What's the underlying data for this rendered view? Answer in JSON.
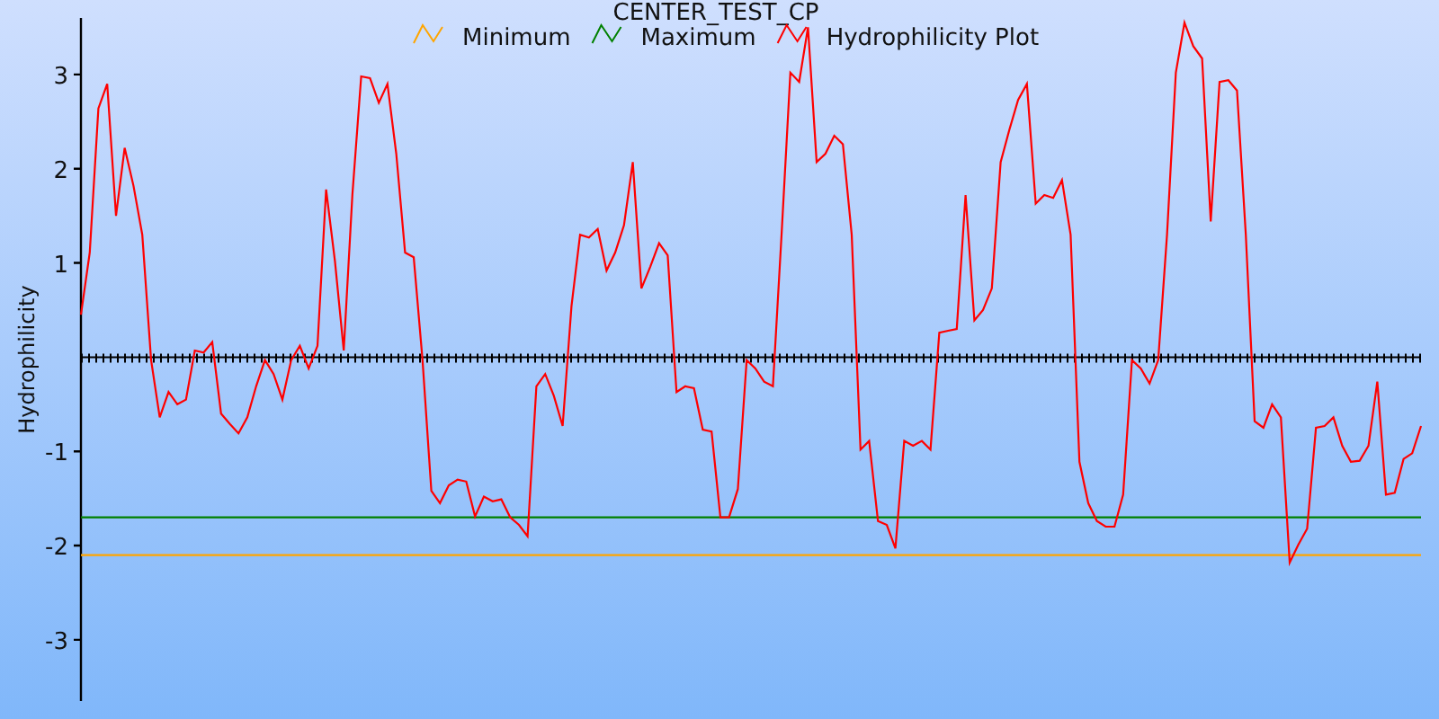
{
  "chart": {
    "chart_data": {
      "type": "line",
      "title": "CENTER_TEST_CP",
      "ylabel": "Hydrophilicity",
      "legend": "top",
      "ylim": [
        -3.65,
        3.6
      ],
      "yticks": [
        -3,
        -2,
        -1,
        1,
        2,
        3
      ],
      "categories": [
        null,
        null,
        null,
        null,
        null,
        null,
        null,
        null,
        null,
        null,
        null,
        null,
        null,
        null,
        null,
        null,
        null,
        null,
        null,
        null,
        null,
        null,
        null,
        null,
        null,
        null,
        null,
        null,
        null,
        null,
        null,
        null,
        null,
        null,
        null,
        null,
        null,
        null,
        null,
        null,
        null,
        null,
        null,
        null,
        null,
        null,
        null,
        null,
        null,
        null,
        null,
        null,
        null,
        null,
        null,
        null,
        null,
        null,
        null,
        null,
        null,
        null,
        null,
        null,
        null,
        null,
        null,
        null,
        null,
        null,
        null,
        null,
        null,
        null,
        null,
        null,
        null,
        null,
        null,
        null,
        null,
        null,
        null,
        null,
        null,
        null,
        null,
        null,
        null,
        null,
        null,
        null,
        null,
        null,
        null,
        null,
        null,
        null,
        null,
        null,
        null,
        null,
        null,
        null,
        null,
        null,
        null,
        null,
        null,
        null,
        null,
        null,
        null,
        null,
        null,
        null,
        null,
        null,
        null,
        null,
        null,
        null,
        null,
        null,
        null,
        null,
        null,
        null,
        null,
        null,
        null,
        null,
        null,
        null,
        null,
        null,
        null,
        null,
        null,
        null,
        null,
        null,
        null,
        null,
        null,
        null,
        null,
        null,
        null,
        null,
        null,
        null,
        null,
        null
      ],
      "series": [
        {
          "name": "Minimum",
          "color": "#ffa500",
          "values": [
            -2.1,
            -2.1,
            -2.1,
            -2.1,
            -2.1,
            -2.1,
            -2.1,
            -2.1,
            -2.1,
            -2.1,
            -2.1,
            -2.1,
            -2.1,
            -2.1,
            -2.1,
            -2.1,
            -2.1,
            -2.1,
            -2.1,
            -2.1,
            -2.1,
            -2.1,
            -2.1,
            -2.1,
            -2.1,
            -2.1,
            -2.1,
            -2.1,
            -2.1,
            -2.1,
            -2.1,
            -2.1,
            -2.1,
            -2.1,
            -2.1,
            -2.1,
            -2.1,
            -2.1,
            -2.1,
            -2.1,
            -2.1,
            -2.1,
            -2.1,
            -2.1,
            -2.1,
            -2.1,
            -2.1,
            -2.1,
            -2.1,
            -2.1,
            -2.1,
            -2.1,
            -2.1,
            -2.1,
            -2.1,
            -2.1,
            -2.1,
            -2.1,
            -2.1,
            -2.1,
            -2.1,
            -2.1,
            -2.1,
            -2.1,
            -2.1,
            -2.1,
            -2.1,
            -2.1,
            -2.1,
            -2.1,
            -2.1,
            -2.1,
            -2.1,
            -2.1,
            -2.1,
            -2.1,
            -2.1,
            -2.1,
            -2.1,
            -2.1,
            -2.1,
            -2.1,
            -2.1,
            -2.1,
            -2.1,
            -2.1,
            -2.1,
            -2.1,
            -2.1,
            -2.1,
            -2.1,
            -2.1,
            -2.1,
            -2.1,
            -2.1,
            -2.1,
            -2.1,
            -2.1,
            -2.1,
            -2.1,
            -2.1,
            -2.1,
            -2.1,
            -2.1,
            -2.1,
            -2.1,
            -2.1,
            -2.1,
            -2.1,
            -2.1,
            -2.1,
            -2.1,
            -2.1,
            -2.1,
            -2.1,
            -2.1,
            -2.1,
            -2.1,
            -2.1,
            -2.1,
            -2.1,
            -2.1,
            -2.1,
            -2.1,
            -2.1,
            -2.1,
            -2.1,
            -2.1,
            -2.1,
            -2.1,
            -2.1,
            -2.1,
            -2.1,
            -2.1,
            -2.1,
            -2.1,
            -2.1,
            -2.1,
            -2.1,
            -2.1,
            -2.1,
            -2.1,
            -2.1,
            -2.1,
            -2.1,
            -2.1,
            -2.1,
            -2.1,
            -2.1,
            -2.1,
            -2.1,
            -2.1,
            -2.1,
            -2.1
          ]
        },
        {
          "name": "Maximum",
          "color": "#008000",
          "values": [
            -1.7,
            -1.7,
            -1.7,
            -1.7,
            -1.7,
            -1.7,
            -1.7,
            -1.7,
            -1.7,
            -1.7,
            -1.7,
            -1.7,
            -1.7,
            -1.7,
            -1.7,
            -1.7,
            -1.7,
            -1.7,
            -1.7,
            -1.7,
            -1.7,
            -1.7,
            -1.7,
            -1.7,
            -1.7,
            -1.7,
            -1.7,
            -1.7,
            -1.7,
            -1.7,
            -1.7,
            -1.7,
            -1.7,
            -1.7,
            -1.7,
            -1.7,
            -1.7,
            -1.7,
            -1.7,
            -1.7,
            -1.7,
            -1.7,
            -1.7,
            -1.7,
            -1.7,
            -1.7,
            -1.7,
            -1.7,
            -1.7,
            -1.7,
            -1.7,
            -1.7,
            -1.7,
            -1.7,
            -1.7,
            -1.7,
            -1.7,
            -1.7,
            -1.7,
            -1.7,
            -1.7,
            -1.7,
            -1.7,
            -1.7,
            -1.7,
            -1.7,
            -1.7,
            -1.7,
            -1.7,
            -1.7,
            -1.7,
            -1.7,
            -1.7,
            -1.7,
            -1.7,
            -1.7,
            -1.7,
            -1.7,
            -1.7,
            -1.7,
            -1.7,
            -1.7,
            -1.7,
            -1.7,
            -1.7,
            -1.7,
            -1.7,
            -1.7,
            -1.7,
            -1.7,
            -1.7,
            -1.7,
            -1.7,
            -1.7,
            -1.7,
            -1.7,
            -1.7,
            -1.7,
            -1.7,
            -1.7,
            -1.7,
            -1.7,
            -1.7,
            -1.7,
            -1.7,
            -1.7,
            -1.7,
            -1.7,
            -1.7,
            -1.7,
            -1.7,
            -1.7,
            -1.7,
            -1.7,
            -1.7,
            -1.7,
            -1.7,
            -1.7,
            -1.7,
            -1.7,
            -1.7,
            -1.7,
            -1.7,
            -1.7,
            -1.7,
            -1.7,
            -1.7,
            -1.7,
            -1.7,
            -1.7,
            -1.7,
            -1.7,
            -1.7,
            -1.7,
            -1.7,
            -1.7,
            -1.7,
            -1.7,
            -1.7,
            -1.7,
            -1.7,
            -1.7,
            -1.7,
            -1.7,
            -1.7,
            -1.7,
            -1.7,
            -1.7,
            -1.7,
            -1.7,
            -1.7,
            -1.7,
            -1.7,
            -1.7
          ]
        },
        {
          "name": "Hydrophilicity Plot",
          "color": "#ff0000",
          "values": [
            0.45,
            1.11,
            2.64,
            2.9,
            1.5,
            2.22,
            1.82,
            1.3,
            -0.03,
            -0.64,
            -0.37,
            -0.5,
            -0.45,
            0.07,
            0.05,
            0.16,
            -0.6,
            -0.71,
            -0.81,
            -0.64,
            -0.31,
            -0.03,
            -0.18,
            -0.45,
            -0.03,
            0.12,
            -0.12,
            0.12,
            1.78,
            1.02,
            0.07,
            1.72,
            2.98,
            2.96,
            2.7,
            2.9,
            2.16,
            1.11,
            1.06,
            -0.03,
            -1.42,
            -1.55,
            -1.36,
            -1.3,
            -1.32,
            -1.69,
            -1.48,
            -1.53,
            -1.51,
            -1.7,
            -1.78,
            -1.9,
            -0.31,
            -0.18,
            -0.41,
            -0.73,
            0.54,
            1.3,
            1.27,
            1.36,
            0.92,
            1.11,
            1.4,
            2.07,
            0.73,
            0.96,
            1.21,
            1.08,
            -0.37,
            -0.31,
            -0.33,
            -0.77,
            -0.79,
            -1.7,
            -1.7,
            -1.4,
            -0.03,
            -0.12,
            -0.26,
            -0.31,
            1.3,
            3.02,
            2.92,
            3.5,
            2.07,
            2.16,
            2.35,
            2.26,
            1.3,
            -0.98,
            -0.89,
            -1.74,
            -1.78,
            -2.03,
            -0.89,
            -0.94,
            -0.89,
            -0.98,
            0.26,
            0.28,
            0.3,
            1.72,
            0.39,
            0.5,
            0.73,
            2.07,
            2.41,
            2.73,
            2.9,
            1.63,
            1.72,
            1.69,
            1.88,
            1.3,
            -1.11,
            -1.55,
            -1.74,
            -1.8,
            -1.8,
            -1.46,
            -0.03,
            -0.12,
            -0.28,
            -0.03,
            1.3,
            3.02,
            3.55,
            3.3,
            3.17,
            1.44,
            2.92,
            2.94,
            2.83,
            1.3,
            -0.68,
            -0.75,
            -0.5,
            -0.64,
            -2.18,
            -1.99,
            -1.82,
            -0.75,
            -0.73,
            -0.64,
            -0.94,
            -1.11,
            -1.1,
            -0.94,
            -0.26,
            -1.46,
            -1.44,
            -1.08,
            -1.02,
            -0.73
          ]
        }
      ]
    }
  }
}
